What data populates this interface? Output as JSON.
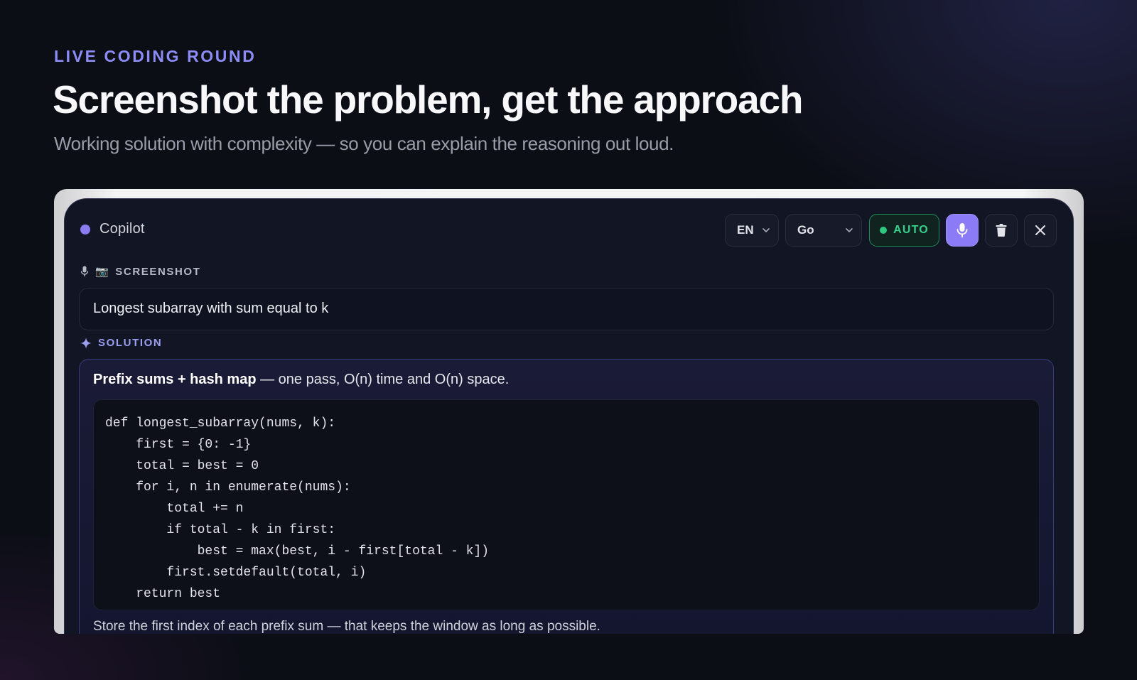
{
  "hero": {
    "eyebrow": "LIVE CODING ROUND",
    "headline": "Screenshot the problem, get the approach",
    "subhead": "Working solution with complexity — so you can explain the reasoning out loud."
  },
  "copilot": {
    "title": "Copilot",
    "controls": {
      "language": "EN",
      "code_language": "Go",
      "auto_label": "AUTO",
      "mic_icon": "microphone-icon",
      "trash_icon": "trash-icon",
      "close_icon": "close-icon"
    },
    "screenshot_section": {
      "label": "SCREENSHOT",
      "emoji": "📷",
      "text": "Longest subarray with sum equal to k"
    },
    "solution_section": {
      "label": "SOLUTION",
      "summary_bold": "Prefix sums + hash map",
      "summary_rest": " — one pass, O(n) time and O(n) space.",
      "code_lines": [
        "def longest_subarray(nums, k):",
        "    first = {0: -1}",
        "    total = best = 0",
        "    for i, n in enumerate(nums):",
        "        total += n",
        "        if total - k in first:",
        "            best = max(best, i - first[total - k])",
        "        first.setdefault(total, i)",
        "    return best"
      ],
      "note": "Store the first index of each prefix sum — that keeps the window as long as possible."
    }
  },
  "colors": {
    "accent": "#8b7cf2",
    "auto_green": "#36d08a",
    "background": "#0c0e16"
  }
}
